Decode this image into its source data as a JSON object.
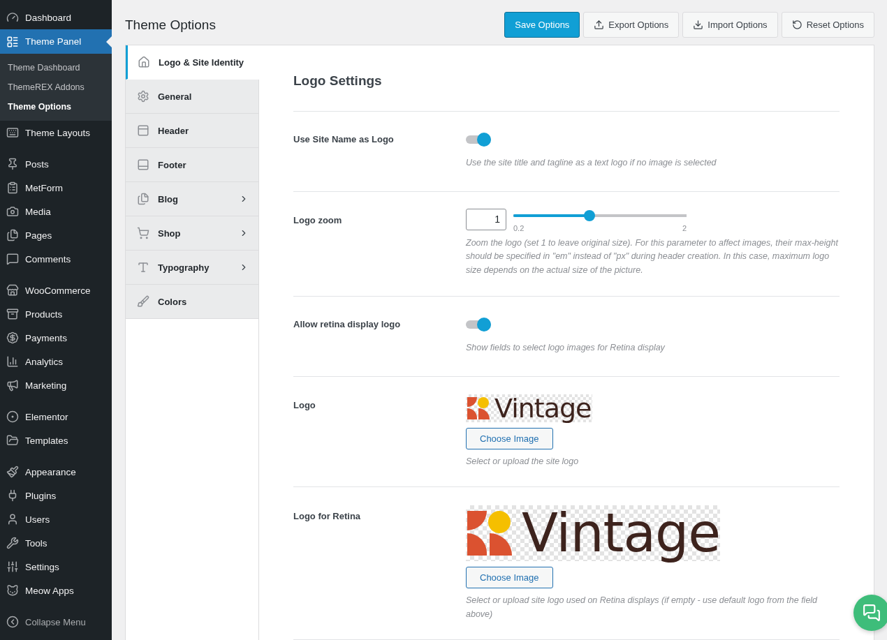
{
  "sidebar": {
    "groups": [
      [
        {
          "label": "Dashboard",
          "selected": false
        },
        {
          "label": "Theme Panel",
          "selected": true,
          "children": [
            {
              "label": "Theme Dashboard",
              "selected": false
            },
            {
              "label": "ThemeREX Addons",
              "selected": false
            },
            {
              "label": "Theme Options",
              "selected": true
            }
          ]
        },
        {
          "label": "Theme Layouts",
          "selected": false
        }
      ],
      [
        {
          "label": "Posts",
          "selected": false
        },
        {
          "label": "MetForm",
          "selected": false
        },
        {
          "label": "Media",
          "selected": false
        },
        {
          "label": "Pages",
          "selected": false
        },
        {
          "label": "Comments",
          "selected": false
        }
      ],
      [
        {
          "label": "WooCommerce",
          "selected": false
        },
        {
          "label": "Products",
          "selected": false
        },
        {
          "label": "Payments",
          "selected": false
        },
        {
          "label": "Analytics",
          "selected": false
        },
        {
          "label": "Marketing",
          "selected": false
        }
      ],
      [
        {
          "label": "Elementor",
          "selected": false
        },
        {
          "label": "Templates",
          "selected": false
        }
      ],
      [
        {
          "label": "Appearance",
          "selected": false
        },
        {
          "label": "Plugins",
          "selected": false
        },
        {
          "label": "Users",
          "selected": false
        },
        {
          "label": "Tools",
          "selected": false
        },
        {
          "label": "Settings",
          "selected": false
        },
        {
          "label": "Meow Apps",
          "selected": false
        }
      ]
    ],
    "collapse": "Collapse Menu"
  },
  "page_title": "Theme Options",
  "toolbar": [
    {
      "label": "Save Options",
      "kind": "primary"
    },
    {
      "label": "Export Options",
      "kind": "export"
    },
    {
      "label": "Import Options",
      "kind": "import"
    },
    {
      "label": "Reset Options",
      "kind": "reset"
    }
  ],
  "tabs": [
    {
      "label": "Logo & Site Identity",
      "selected": true,
      "expandable": false
    },
    {
      "label": "General",
      "selected": false,
      "expandable": false
    },
    {
      "label": "Header",
      "selected": false,
      "expandable": false
    },
    {
      "label": "Footer",
      "selected": false,
      "expandable": false
    },
    {
      "label": "Blog",
      "selected": false,
      "expandable": true
    },
    {
      "label": "Shop",
      "selected": false,
      "expandable": true
    },
    {
      "label": "Typography",
      "selected": false,
      "expandable": true
    },
    {
      "label": "Colors",
      "selected": false,
      "expandable": false
    }
  ],
  "section": {
    "title": "Logo Settings",
    "rows": [
      {
        "kind": "toggle",
        "label": "Use Site Name as Logo",
        "on": true,
        "description": "Use the site title and tagline as a text logo if no image is selected"
      },
      {
        "kind": "slider",
        "label": "Logo zoom",
        "value": "1",
        "level": 0.44,
        "min_label": "0.2",
        "max_label": "2",
        "description": "Zoom the logo (set 1 to leave original size). For this parameter to affect images, their max-height should be specified in \"em\" instead of \"px\" during header creation. In this case, maximum logo size depends on the actual size of the picture."
      },
      {
        "kind": "toggle",
        "label": "Allow retina display logo",
        "on": true,
        "description": "Show fields to select logo images for Retina display"
      },
      {
        "kind": "image",
        "label": "Logo",
        "logo_text": "Vintage",
        "button": "Choose Image",
        "description": "Select or upload the site logo"
      },
      {
        "kind": "retina_image",
        "label": "Logo for Retina",
        "logo_text": "Vintage",
        "button": "Choose Image",
        "description": "Select or upload site logo used on Retina displays (if empty - use default logo from the field above)"
      }
    ]
  }
}
